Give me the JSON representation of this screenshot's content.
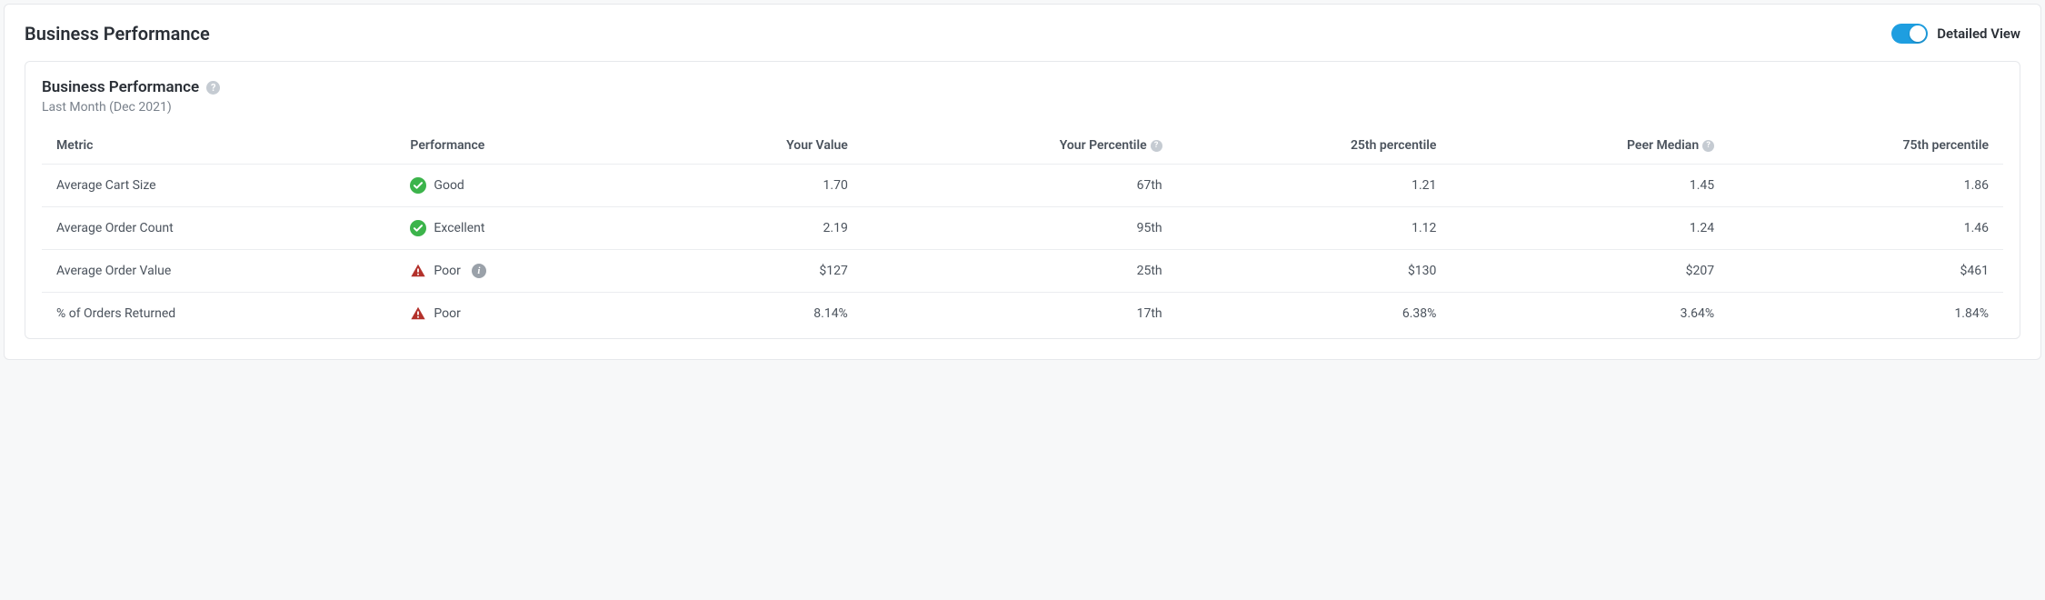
{
  "header": {
    "title": "Business Performance",
    "toggle_label": "Detailed View"
  },
  "card": {
    "title": "Business Performance",
    "subtitle": "Last Month (Dec 2021)"
  },
  "columns": {
    "metric": "Metric",
    "performance": "Performance",
    "your_value": "Your Value",
    "your_percentile": "Your Percentile",
    "p25": "25th percentile",
    "peer_median": "Peer Median",
    "p75": "75th percentile"
  },
  "rows": [
    {
      "metric": "Average Cart Size",
      "status": "good",
      "performance": "Good",
      "has_info": false,
      "your_value": "1.70",
      "your_percentile": "67th",
      "p25": "1.21",
      "peer_median": "1.45",
      "p75": "1.86"
    },
    {
      "metric": "Average Order Count",
      "status": "good",
      "performance": "Excellent",
      "has_info": false,
      "your_value": "2.19",
      "your_percentile": "95th",
      "p25": "1.12",
      "peer_median": "1.24",
      "p75": "1.46"
    },
    {
      "metric": "Average Order Value",
      "status": "poor",
      "performance": "Poor",
      "has_info": true,
      "your_value": "$127",
      "your_percentile": "25th",
      "p25": "$130",
      "peer_median": "$207",
      "p75": "$461"
    },
    {
      "metric": "% of Orders Returned",
      "status": "poor",
      "performance": "Poor",
      "has_info": false,
      "your_value": "8.14%",
      "your_percentile": "17th",
      "p25": "6.38%",
      "peer_median": "3.64%",
      "p75": "1.84%"
    }
  ]
}
